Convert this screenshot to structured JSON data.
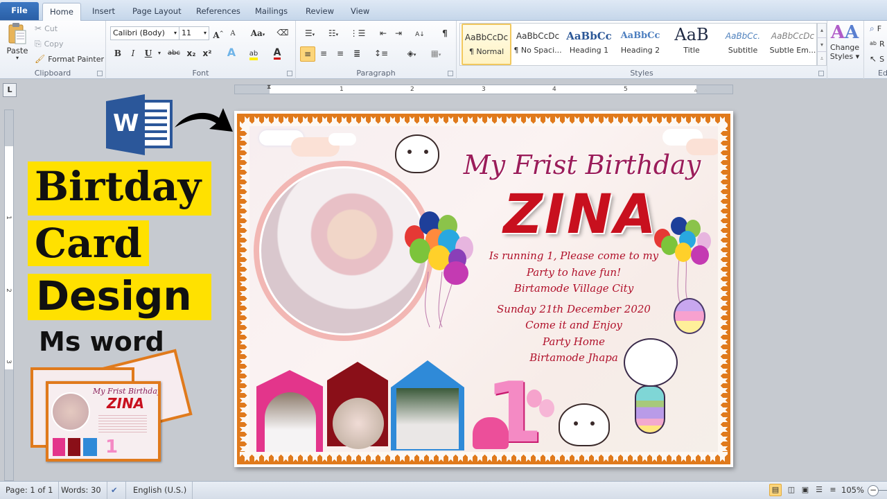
{
  "tabs": [
    {
      "label": "File",
      "active": false
    },
    {
      "label": "Home",
      "active": true
    },
    {
      "label": "Insert",
      "active": false
    },
    {
      "label": "Page Layout",
      "active": false
    },
    {
      "label": "References",
      "active": false
    },
    {
      "label": "Mailings",
      "active": false
    },
    {
      "label": "Review",
      "active": false
    },
    {
      "label": "View",
      "active": false
    }
  ],
  "ribbon": {
    "clipboard": {
      "label": "Clipboard",
      "paste": "Paste",
      "cut": "Cut",
      "copy": "Copy",
      "format_painter": "Format Painter"
    },
    "font": {
      "label": "Font",
      "font_name": "Calibri (Body)",
      "font_size": "11",
      "grow_font": "A",
      "shrink_font": "A",
      "change_case": "Aa",
      "bold": "B",
      "italic": "I",
      "underline": "U",
      "strikethrough": "abc",
      "subscript": "x₂",
      "superscript": "x²",
      "font_color_hex": "#d00000"
    },
    "paragraph": {
      "label": "Paragraph",
      "show_marks": "¶"
    },
    "styles": {
      "label": "Styles",
      "items": [
        {
          "preview": "AaBbCcDc",
          "name": "¶ Normal",
          "selected": true
        },
        {
          "preview": "AaBbCcDc",
          "name": "¶ No Spaci...",
          "selected": false
        },
        {
          "preview": "AaBbCc",
          "name": "Heading 1",
          "selected": false
        },
        {
          "preview": "AaBbCc",
          "name": "Heading 2",
          "selected": false
        },
        {
          "preview": "AaB",
          "name": "Title",
          "selected": false
        },
        {
          "preview": "AaBbCc.",
          "name": "Subtitle",
          "selected": false
        },
        {
          "preview": "AaBbCcDc",
          "name": "Subtle Em...",
          "selected": false
        }
      ],
      "change_styles_line1": "Change",
      "change_styles_line2": "Styles ▾"
    },
    "editing": {
      "label": "Ed",
      "find": "F",
      "replace": "R",
      "select": "S"
    }
  },
  "ruler": {
    "corner": "L",
    "h_numbers": [
      "1",
      "2",
      "3",
      "4",
      "5"
    ],
    "v_numbers": [
      "1",
      "2",
      "3"
    ]
  },
  "promo": {
    "line1": "Birtday",
    "line2": "Card",
    "line3": "Design",
    "line4": "Ms word",
    "word_logo_letter": "W",
    "highlight_color": "#ffe100"
  },
  "card": {
    "heading": "My Frist Birthday",
    "name": "ZINA",
    "lines": [
      "Is running 1, Please come to my",
      "Party to have fun!",
      "Birtamode Village City",
      "Sunday 21th December 2020",
      "Come it and Enjoy",
      "Party Home",
      "Birtamode Jhapa"
    ],
    "big_number": "1",
    "border_color": "#e07a1c",
    "name_color": "#c8101e",
    "text_color": "#b0102a"
  },
  "thumb": {
    "heading": "My Frist Birthday",
    "name": "ZINA"
  },
  "status": {
    "page": "Page: 1 of 1",
    "words": "Words: 30",
    "language": "English (U.S.)",
    "zoom": "105%"
  }
}
